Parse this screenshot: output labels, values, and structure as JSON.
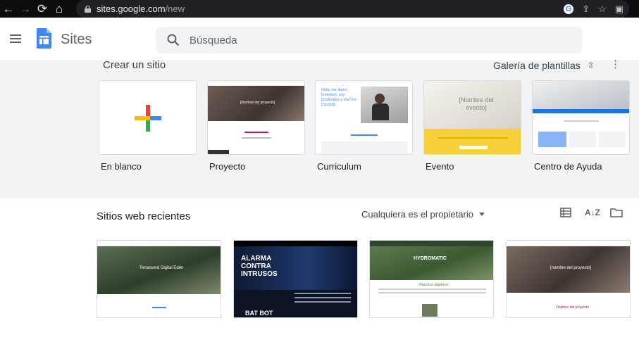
{
  "browser": {
    "url_host": "sites.google.com",
    "url_path": "/new",
    "g_badge": "G"
  },
  "app": {
    "name": "Sites",
    "search_placeholder": "Búsqueda"
  },
  "templates": {
    "title": "Crear un sitio",
    "gallery_label": "Galería de plantillas",
    "items": [
      {
        "label": "En blanco"
      },
      {
        "label": "Proyecto",
        "preview_title": "[Nombre del proyecto]"
      },
      {
        "label": "Curriculum",
        "preview_title": "Hola, me llamo [nombre], soy [profesión] y vivo en [ciudad]."
      },
      {
        "label": "Evento",
        "preview_title": "[Nombre del evento]"
      },
      {
        "label": "Centro de Ayuda"
      }
    ]
  },
  "recent": {
    "title": "Sitios web recientes",
    "owner_filter": "Cualquiera es el propietario",
    "sites": [
      {
        "preview_title": "Terrasverd Digital Edén"
      },
      {
        "preview_title": "ALARMA CONTRA INTRUSOS",
        "preview_footer": "BAT BOT"
      },
      {
        "preview_title": "HYDROMATIC",
        "preview_subtitle": "Nuestros objetivos"
      },
      {
        "preview_title": "[nombre del proyecto]",
        "preview_subtitle": "Objetivo del proyecto"
      }
    ]
  }
}
